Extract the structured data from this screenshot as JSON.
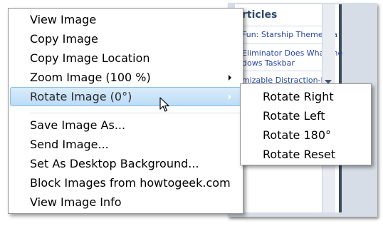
{
  "background_page": {
    "heading": "rticles",
    "links": [
      "Fun: Starship Theme Wa",
      "Eliminator Does What the",
      "dows Taskbar",
      "mizable Distraction-Fre"
    ]
  },
  "context_menu": {
    "items": [
      {
        "label": "View Image"
      },
      {
        "label": "Copy Image"
      },
      {
        "label": "Copy Image Location"
      },
      {
        "label": "Zoom Image (100 %)"
      },
      {
        "label": "Rotate Image (0°)"
      },
      {
        "label": "Save Image As..."
      },
      {
        "label": "Send Image..."
      },
      {
        "label": "Set As Desktop Background..."
      },
      {
        "label": "Block Images from howtogeek.com"
      },
      {
        "label": "View Image Info"
      }
    ]
  },
  "submenu": {
    "items": [
      {
        "label": "Rotate Right"
      },
      {
        "label": "Rotate Left"
      },
      {
        "label": "Rotate 180°"
      },
      {
        "label": "Rotate Reset"
      }
    ]
  },
  "colors": {
    "highlight": "#bcdcf6",
    "highlight_border": "#89bde8",
    "link": "#2443a6",
    "menu_border": "#979797"
  }
}
